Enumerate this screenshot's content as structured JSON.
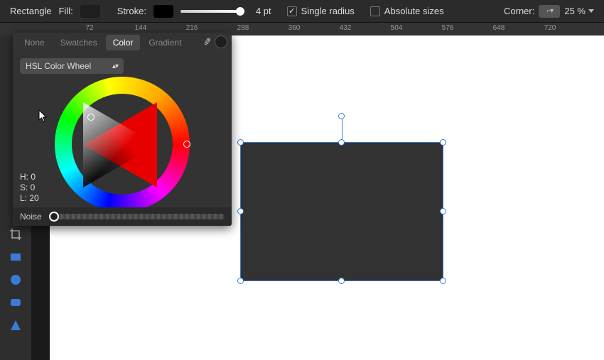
{
  "ctx": {
    "shape_label": "Rectangle",
    "fill_label": "Fill:",
    "stroke_label": "Stroke:",
    "stroke_value": "4 pt",
    "single_radius": "Single radius",
    "absolute_sizes": "Absolute sizes",
    "corner_label": "Corner:",
    "corner_pct": "25 %"
  },
  "ruler": {
    "ticks": [
      "72",
      "144",
      "216",
      "288",
      "360",
      "432",
      "504",
      "576",
      "648",
      "720"
    ]
  },
  "popover": {
    "tabs": {
      "none": "None",
      "swatches": "Swatches",
      "color": "Color",
      "gradient": "Gradient"
    },
    "model": "HSL Color Wheel",
    "hsl": {
      "h": "H: 0",
      "s": "S: 0",
      "l": "L: 20"
    },
    "noise_label": "Noise"
  },
  "colors": {
    "selection": "#3a7bd5",
    "shape_fill": "#323232",
    "panel": "#333333",
    "hue": "red"
  }
}
